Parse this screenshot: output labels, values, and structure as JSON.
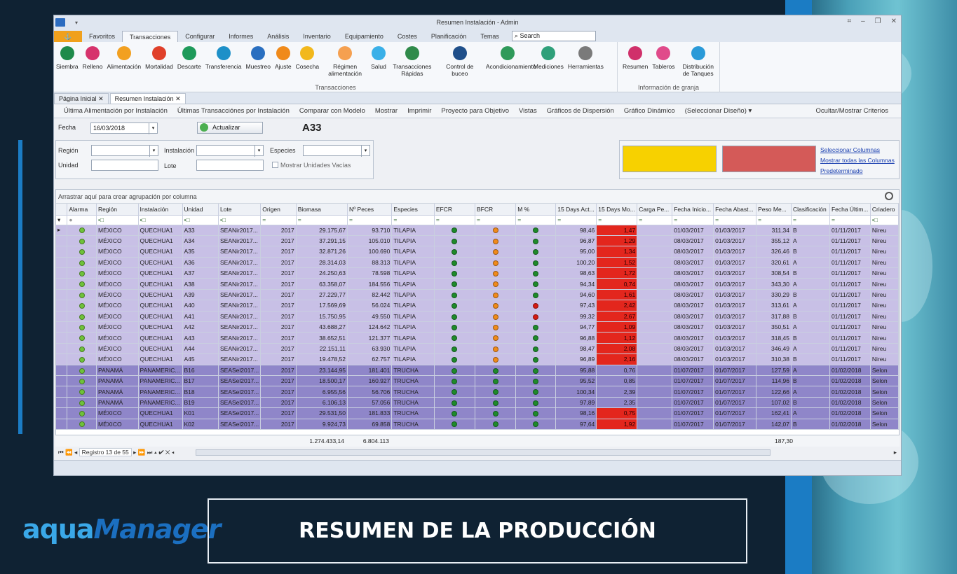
{
  "window": {
    "title": "Resumen Instalación - Admin"
  },
  "ribbon_tabs": [
    "Favoritos",
    "Transacciones",
    "Configurar",
    "Informes",
    "Análisis",
    "Inventario",
    "Equipamiento",
    "Costes",
    "Planificación",
    "Temas"
  ],
  "search_placeholder": "Search",
  "ribbon": {
    "transacciones_group": "Transacciones",
    "granja_group": "Información de granja",
    "buttons": [
      {
        "label": "Siembra",
        "color": "#1e8a4a",
        "icon": "minus-circle-icon"
      },
      {
        "label": "Relleno",
        "color": "#d6336c",
        "icon": "fish-icon"
      },
      {
        "label": "Alimentación",
        "color": "#f2a020",
        "icon": "feed-icon"
      },
      {
        "label": "Mortalidad",
        "color": "#e0402a",
        "icon": "x-icon"
      },
      {
        "label": "Descarte",
        "color": "#1e9a5a",
        "icon": "down-arrow-icon"
      },
      {
        "label": "Transferencia",
        "color": "#1e90c8",
        "icon": "transfer-icon"
      },
      {
        "label": "Muestreo",
        "color": "#2a6fc0",
        "icon": "bar-chart-icon"
      },
      {
        "label": "Ajuste",
        "color": "#f08a1a",
        "icon": "pencil-icon"
      },
      {
        "label": "Cosecha",
        "color": "#f2b81c",
        "icon": "sun-icon"
      },
      {
        "label": "Régimen alimentación",
        "color": "#f5a050",
        "icon": "regime-icon"
      },
      {
        "label": "Salud",
        "color": "#3ab0e8",
        "icon": "drop-icon"
      },
      {
        "label": "Transacciones Rápidas",
        "color": "#2f8a4a",
        "icon": "grid-icon"
      },
      {
        "label": "Control de buceo",
        "color": "#1f4f8a",
        "icon": "diver-icon"
      }
    ],
    "buttons2": [
      {
        "label": "Acondicionamiento",
        "color": "#2f9a5a",
        "icon": "waves-icon"
      },
      {
        "label": "Mediciones",
        "color": "#2fa07a",
        "icon": "thermometer-icon"
      },
      {
        "label": "Herramientas",
        "color": "#7a7a7a",
        "icon": "tools-icon"
      }
    ],
    "buttons3": [
      {
        "label": "Resumen",
        "color": "#d0306a",
        "icon": "summary-icon"
      },
      {
        "label": "Tableros",
        "color": "#e04a8a",
        "icon": "dashboard-icon"
      },
      {
        "label": "Distribución de Tanques",
        "color": "#2a9ad8",
        "icon": "tanks-icon"
      }
    ]
  },
  "doc_tabs": [
    "Página Inicial",
    "Resumen Instalación"
  ],
  "toolbar": [
    "Última Alimentación por Instalación",
    "Últimas Transacciónes por Instalación",
    "Comparar con Modelo",
    "Mostrar",
    "Imprimir",
    "Proyecto para Objetivo",
    "Vistas",
    "Gráficos de Dispersión",
    "Gráfico Dinámico",
    "(Seleccionar Diseño) ▾"
  ],
  "toolbar_right": "Ocultar/Mostrar Criterios",
  "fecha": {
    "label": "Fecha",
    "value": "16/03/2018",
    "update": "Actualizar",
    "unit": "A33"
  },
  "filters": {
    "region": "Región",
    "instalacion": "Instalación",
    "especies": "Especies",
    "unidad": "Unidad",
    "lote": "Lote",
    "vacias": "Mostrar Unidades Vacías"
  },
  "links": [
    "Seleccionar Columnas",
    "Mostrar todas las Columnas",
    "Predeterminado"
  ],
  "colors": {
    "yellow": "#f7d100",
    "red": "#d45a58"
  },
  "group_hint": "Arrastrar aquí para crear agrupación por columna",
  "columns": [
    "Alarma",
    "Región",
    "Instalación",
    "Unidad",
    "Lote",
    "Origen",
    "Biomasa",
    "Nº Peces",
    "Especies",
    "EFCR",
    "BFCR",
    "M %",
    "15 Days Act...",
    "15 Days Mo...",
    "Carga Pe...",
    "Fecha Inicio...",
    "Fecha Abast...",
    "Peso Me...",
    "Clasificación",
    "Fecha Últim...",
    "Criadero"
  ],
  "rows": [
    [
      "MÉXICO",
      "QUECHUA1",
      "A33",
      "SEANir2017...",
      "2017",
      "29.175,67",
      "93.710",
      "TILAPIA",
      "g",
      "o",
      "g",
      "98,46",
      "1,47",
      "",
      "01/03/2017",
      "01/03/2017",
      "311,34",
      "B",
      "01/11/2017",
      "Nireu"
    ],
    [
      "MÉXICO",
      "QUECHUA1",
      "A34",
      "SEANir2017...",
      "2017",
      "37.291,15",
      "105.010",
      "TILAPIA",
      "g",
      "o",
      "g",
      "96,87",
      "1,29",
      "",
      "08/03/2017",
      "01/03/2017",
      "355,12",
      "A",
      "01/11/2017",
      "Nireu"
    ],
    [
      "MÉXICO",
      "QUECHUA1",
      "A35",
      "SEANir2017...",
      "2017",
      "32.871,26",
      "100.690",
      "TILAPIA",
      "g",
      "o",
      "g",
      "95,00",
      "1,34",
      "",
      "08/03/2017",
      "01/03/2017",
      "326,46",
      "B",
      "01/11/2017",
      "Nireu"
    ],
    [
      "MÉXICO",
      "QUECHUA1",
      "A36",
      "SEANir2017...",
      "2017",
      "28.314,03",
      "88.313",
      "TILAPIA",
      "g",
      "o",
      "g",
      "100,20",
      "1,52",
      "",
      "08/03/2017",
      "01/03/2017",
      "320,61",
      "A",
      "01/11/2017",
      "Nireu"
    ],
    [
      "MÉXICO",
      "QUECHUA1",
      "A37",
      "SEANir2017...",
      "2017",
      "24.250,63",
      "78.598",
      "TILAPIA",
      "g",
      "o",
      "g",
      "98,63",
      "1,72",
      "",
      "08/03/2017",
      "01/03/2017",
      "308,54",
      "B",
      "01/11/2017",
      "Nireu"
    ],
    [
      "MÉXICO",
      "QUECHUA1",
      "A38",
      "SEANir2017...",
      "2017",
      "63.358,07",
      "184.556",
      "TILAPIA",
      "g",
      "o",
      "g",
      "94,34",
      "0,74",
      "",
      "08/03/2017",
      "01/03/2017",
      "343,30",
      "A",
      "01/11/2017",
      "Nireu"
    ],
    [
      "MÉXICO",
      "QUECHUA1",
      "A39",
      "SEANir2017...",
      "2017",
      "27.229,77",
      "82.442",
      "TILAPIA",
      "g",
      "o",
      "g",
      "94,60",
      "1,61",
      "",
      "08/03/2017",
      "01/03/2017",
      "330,29",
      "B",
      "01/11/2017",
      "Nireu"
    ],
    [
      "MÉXICO",
      "QUECHUA1",
      "A40",
      "SEANir2017...",
      "2017",
      "17.569,69",
      "56.024",
      "TILAPIA",
      "g",
      "o",
      "r",
      "97,43",
      "2,42",
      "",
      "08/03/2017",
      "01/03/2017",
      "313,61",
      "A",
      "01/11/2017",
      "Nireu"
    ],
    [
      "MÉXICO",
      "QUECHUA1",
      "A41",
      "SEANir2017...",
      "2017",
      "15.750,95",
      "49.550",
      "TILAPIA",
      "g",
      "o",
      "r",
      "99,32",
      "2,67",
      "",
      "08/03/2017",
      "01/03/2017",
      "317,88",
      "B",
      "01/11/2017",
      "Nireu"
    ],
    [
      "MÉXICO",
      "QUECHUA1",
      "A42",
      "SEANir2017...",
      "2017",
      "43.688,27",
      "124.642",
      "TILAPIA",
      "g",
      "o",
      "g",
      "94,77",
      "1,09",
      "",
      "08/03/2017",
      "01/03/2017",
      "350,51",
      "A",
      "01/11/2017",
      "Nireu"
    ],
    [
      "MÉXICO",
      "QUECHUA1",
      "A43",
      "SEANir2017...",
      "2017",
      "38.652,51",
      "121.377",
      "TILAPIA",
      "g",
      "o",
      "g",
      "96,88",
      "1,12",
      "",
      "08/03/2017",
      "01/03/2017",
      "318,45",
      "B",
      "01/11/2017",
      "Nireu"
    ],
    [
      "MÉXICO",
      "QUECHUA1",
      "A44",
      "SEANir2017...",
      "2017",
      "22.151,11",
      "63.930",
      "TILAPIA",
      "g",
      "o",
      "g",
      "98,47",
      "2,08",
      "",
      "08/03/2017",
      "01/03/2017",
      "346,49",
      "A",
      "01/11/2017",
      "Nireu"
    ],
    [
      "MÉXICO",
      "QUECHUA1",
      "A45",
      "SEANir2017...",
      "2017",
      "19.478,52",
      "62.757",
      "TILAPIA",
      "g",
      "o",
      "g",
      "96,89",
      "2,16",
      "",
      "08/03/2017",
      "01/03/2017",
      "310,38",
      "B",
      "01/11/2017",
      "Nireu"
    ],
    [
      "PANAMÁ",
      "PANAMERIC...",
      "B16",
      "SEASel2017...",
      "2017",
      "23.144,95",
      "181.401",
      "TRUCHA",
      "g",
      "g",
      "g",
      "95,88",
      "0,76",
      "",
      "01/07/2017",
      "01/07/2017",
      "127,59",
      "A",
      "01/02/2018",
      "Selon"
    ],
    [
      "PANAMÁ",
      "PANAMERIC...",
      "B17",
      "SEASel2017...",
      "2017",
      "18.500,17",
      "160.927",
      "TRUCHA",
      "g",
      "g",
      "g",
      "95,52",
      "0,85",
      "",
      "01/07/2017",
      "01/07/2017",
      "114,96",
      "B",
      "01/02/2018",
      "Selon"
    ],
    [
      "PANAMÁ",
      "PANAMERIC...",
      "B18",
      "SEASel2017...",
      "2017",
      "6.955,56",
      "56.706",
      "TRUCHA",
      "g",
      "g",
      "g",
      "100,34",
      "2,39",
      "",
      "01/07/2017",
      "01/07/2017",
      "122,66",
      "A",
      "01/02/2018",
      "Selon"
    ],
    [
      "PANAMÁ",
      "PANAMERIC...",
      "B19",
      "SEASel2017...",
      "2017",
      "6.106,13",
      "57.056",
      "TRUCHA",
      "g",
      "g",
      "g",
      "97,89",
      "2,35",
      "",
      "01/07/2017",
      "01/07/2017",
      "107,02",
      "B",
      "01/02/2018",
      "Selon"
    ],
    [
      "MÉXICO",
      "QUECHUA1",
      "K01",
      "SEASel2017...",
      "2017",
      "29.531,50",
      "181.833",
      "TRUCHA",
      "g",
      "g",
      "g",
      "98,16",
      "0,75",
      "",
      "01/07/2017",
      "01/07/2017",
      "162,41",
      "A",
      "01/02/2018",
      "Selon"
    ],
    [
      "MÉXICO",
      "QUECHUA1",
      "K02",
      "SEASel2017...",
      "2017",
      "9.924,73",
      "69.858",
      "TRUCHA",
      "g",
      "g",
      "g",
      "97,64",
      "1,92",
      "",
      "01/07/2017",
      "01/07/2017",
      "142,07",
      "B",
      "01/02/2018",
      "Selon"
    ]
  ],
  "red_cells": [
    0,
    1,
    2,
    3,
    4,
    5,
    6,
    7,
    8,
    9,
    10,
    11,
    12,
    17,
    18
  ],
  "purple_rows": [
    13,
    14,
    15,
    16,
    17,
    18
  ],
  "totals": {
    "biomasa": "1.274.433,14",
    "peces": "6.804.113",
    "peso": "187,30"
  },
  "nav": {
    "record": "Registro 13 de 55"
  },
  "footer": {
    "logo_a": "aqua",
    "logo_b": "Manager",
    "banner": "RESUMEN DE LA PRODUCCIÓN"
  }
}
